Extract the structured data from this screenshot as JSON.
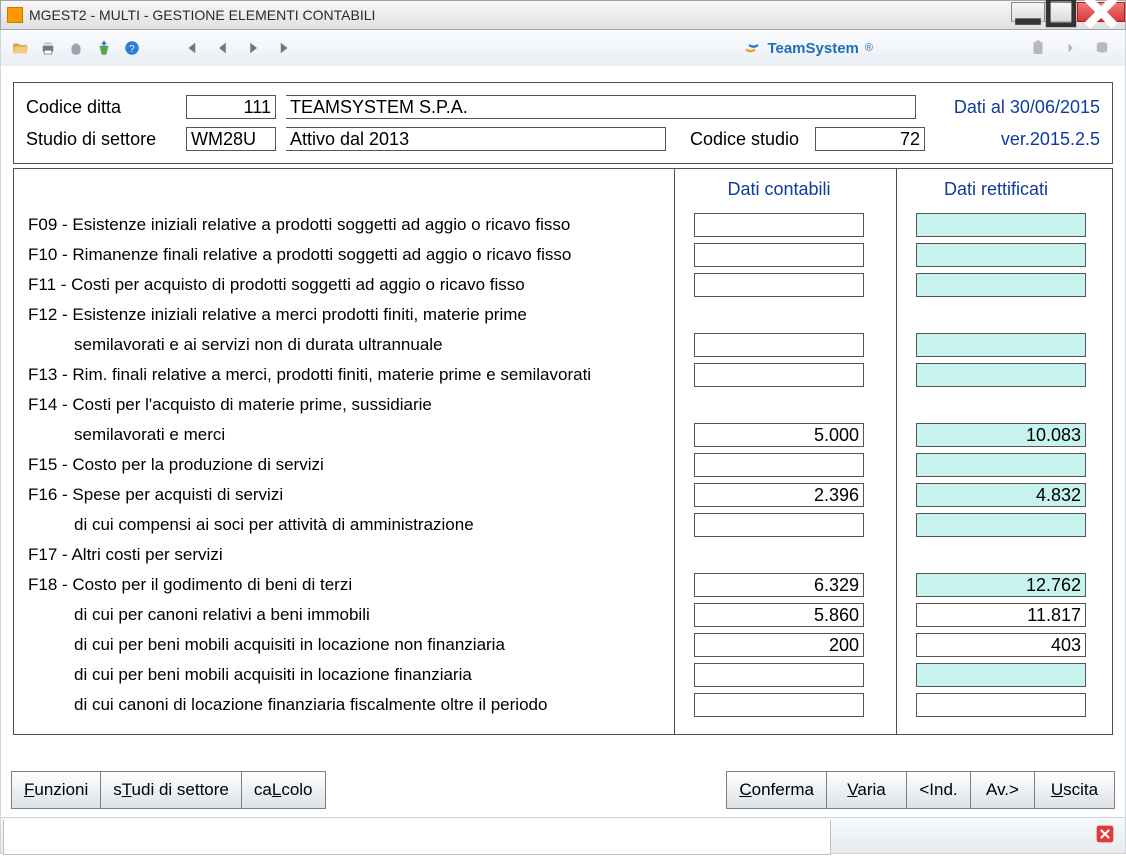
{
  "window": {
    "title": "MGEST2  -  MULTI -   GESTIONE ELEMENTI CONTABILI"
  },
  "brand": "TeamSystem",
  "header": {
    "codice_ditta_label": "Codice ditta",
    "codice_ditta": "111",
    "ragione": "TEAMSYSTEM S.P.A.",
    "dati_al": "Dati al 30/06/2015",
    "studio_settore_label": "Studio di settore",
    "studio_settore": "WM28U",
    "attivo_dal": "Attivo dal 2013",
    "codice_studio_label": "Codice studio",
    "codice_studio": "72",
    "ver": "ver.2015.2.5"
  },
  "columns": {
    "a": "Dati contabili",
    "b": "Dati rettificati"
  },
  "rows": [
    {
      "label": "F09 - Esistenze iniziali relative a prodotti soggetti ad aggio o ricavo fisso",
      "a": "",
      "b": "",
      "b_cyan": true
    },
    {
      "label": "F10 - Rimanenze finali relative a prodotti soggetti ad aggio o ricavo fisso",
      "a": "",
      "b": "",
      "b_cyan": true
    },
    {
      "label": "F11 - Costi per acquisto di prodotti soggetti ad aggio o ricavo fisso",
      "a": "",
      "b": "",
      "b_cyan": true
    },
    {
      "label": "F12 - Esistenze iniziali relative a merci prodotti finiti, materie prime",
      "noinput": true
    },
    {
      "label": "semilavorati e ai servizi non di durata ultrannuale",
      "indent": true,
      "a": "",
      "b": "",
      "b_cyan": true
    },
    {
      "label": "F13 - Rim. finali relative a merci, prodotti finiti, materie prime e semilavorati",
      "a": "",
      "b": "",
      "b_cyan": true
    },
    {
      "label": "F14 - Costi per l'acquisto di materie prime, sussidiarie",
      "noinput": true
    },
    {
      "label": "semilavorati e merci",
      "indent": true,
      "a": "5.000",
      "b": "10.083",
      "b_cyan": true
    },
    {
      "label": "F15 - Costo per la produzione di servizi",
      "a": "",
      "b": "",
      "b_cyan": true
    },
    {
      "label": "F16 - Spese per acquisti di servizi",
      "a": "2.396",
      "b": "4.832",
      "b_cyan": true
    },
    {
      "label": "di cui compensi ai soci per attività di amministrazione",
      "indent": true,
      "a": "",
      "b": "",
      "b_cyan": true
    },
    {
      "label": "F17 - Altri costi per servizi",
      "noinput": true
    },
    {
      "label": "F18 - Costo per il godimento di beni di terzi",
      "a": "6.329",
      "b": "12.762",
      "b_cyan": true
    },
    {
      "label": "di cui per canoni relativi a beni immobili",
      "indent": true,
      "a": "5.860",
      "b": "11.817",
      "b_cyan": false
    },
    {
      "label": "di cui per beni mobili acquisiti in locazione non finanziaria",
      "indent": true,
      "a": "200",
      "b": "403",
      "b_cyan": false
    },
    {
      "label": "di cui per beni mobili acquisiti in locazione finanziaria",
      "indent": true,
      "a": "",
      "b": "",
      "b_cyan": true
    },
    {
      "label": "di cui canoni di locazione finanziaria fiscalmente oltre il periodo",
      "indent": true,
      "a": "",
      "b": "",
      "b_cyan": false
    }
  ],
  "buttons": {
    "funzioni": "Funzioni",
    "studi": "sTudi di settore",
    "calcolo": "caLcolo",
    "conferma": "Conferma",
    "varia": "Varia",
    "ind": "<Ind.",
    "av": "Av.>",
    "uscita": "Uscita"
  }
}
